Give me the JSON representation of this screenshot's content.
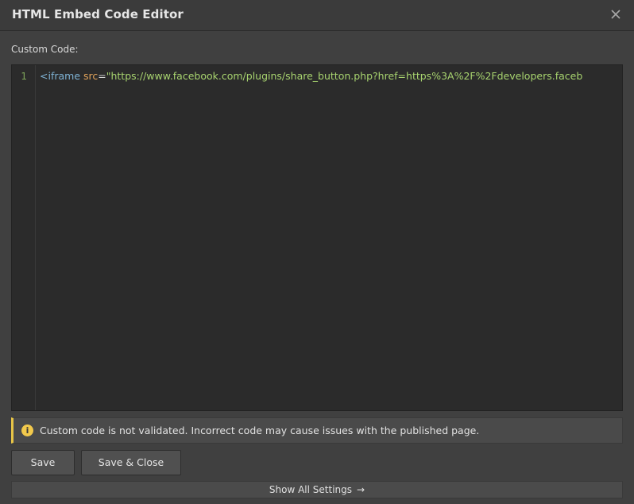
{
  "dialog": {
    "title": "HTML Embed Code Editor",
    "close_icon": "close-icon"
  },
  "editor": {
    "label": "Custom Code:",
    "line_number": "1",
    "code": {
      "tag_open": "<iframe",
      "attr": "src",
      "eq": "=",
      "value": "\"https://www.facebook.com/plugins/share_button.php?href=https%3A%2F%2Fdevelopers.faceb"
    }
  },
  "notice": {
    "icon": "info-icon",
    "text": "Custom code is not validated. Incorrect code may cause issues with the published page.",
    "accent_color": "#e8c547"
  },
  "actions": {
    "save_label": "Save",
    "save_close_label": "Save & Close"
  },
  "settings": {
    "show_all_label": "Show All Settings",
    "arrow_icon": "arrow-right-icon"
  }
}
